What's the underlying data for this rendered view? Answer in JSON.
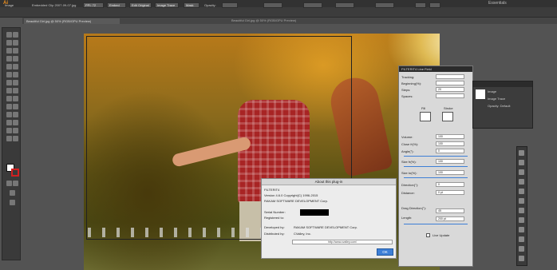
{
  "app": {
    "logo": "Ai",
    "workspace": "Essentials",
    "accent_color": "#f7941e"
  },
  "control_bar": {
    "group_label": "Image",
    "embedded_label": "Embedded Clip 2007-09-07.jpg",
    "ppi_label": "PPI: 72",
    "embed_button": "Embed",
    "edit_original_button": "Edit Original",
    "image_trace_button": "Image Trace",
    "mask_button": "Mask",
    "opacity_label": "Opacity:",
    "x_value": "",
    "y_value": "",
    "w_value": "",
    "h_value": ""
  },
  "document_tab": {
    "tab_label": "Beautiful Girl.jpg @ 50% (RGB/GPU Preview)",
    "window_title": "Beautiful Girl.jpg @ 50% (RGB/GPU Preview)"
  },
  "about_dialog": {
    "title": "About this plug-in",
    "product": "FILTERIT4",
    "version": "Version 4.6.0 Copyright(C) 1996-2015",
    "company": "RAKAM SOFTWARE DEVELOPMENT Corp.",
    "serial_label": "Serial Number:",
    "registered_label": "Registered to:",
    "developed_label": "Developed by:",
    "developed_value": "RAKAM SOFTWARE DEVELOPMENT Corp.",
    "distributed_label": "Distributed by:",
    "distributed_value": "CValley, Inc.",
    "url": "http://www.cvalley.com/",
    "ok_button": "OK"
  },
  "scatter_panel": {
    "title": "FILTERIT4 Line Field",
    "rows": [
      {
        "label": "Tracking:",
        "value": ""
      },
      {
        "label": "Beginning(%):",
        "value": ""
      },
      {
        "label": "Steps:",
        "value": "20"
      },
      {
        "label": "Spaces:",
        "value": ""
      }
    ],
    "fill_label": "Fill",
    "stroke_label": "Stroke",
    "params": [
      {
        "label": "Volume:",
        "value": "100"
      },
      {
        "label": "Close fr(%):",
        "value": "100"
      },
      {
        "label": "Angle(°):",
        "value": "0"
      },
      {
        "label": "Size fr(%):",
        "value": "100"
      },
      {
        "label": "Size to(%):",
        "value": "100"
      },
      {
        "label": "Direction(°):",
        "value": "0"
      },
      {
        "label": "Distance:",
        "value": "0 pt"
      },
      {
        "label": "Drag Direction(°):",
        "value": "45"
      },
      {
        "label": "Length:",
        "value": "200 pt"
      }
    ],
    "live_update_label": "Live Update"
  },
  "appearance_panel": {
    "items": [
      "Image",
      "Image Trace",
      "Opacity: Default"
    ]
  }
}
